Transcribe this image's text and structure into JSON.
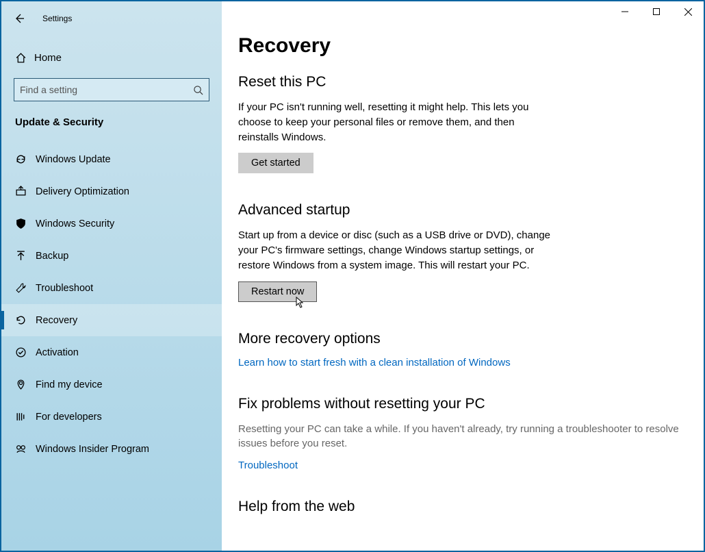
{
  "titlebar": {
    "title": "Settings"
  },
  "home_label": "Home",
  "search": {
    "placeholder": "Find a setting"
  },
  "section": "Update & Security",
  "nav": {
    "items": [
      {
        "label": "Windows Update"
      },
      {
        "label": "Delivery Optimization"
      },
      {
        "label": "Windows Security"
      },
      {
        "label": "Backup"
      },
      {
        "label": "Troubleshoot"
      },
      {
        "label": "Recovery"
      },
      {
        "label": "Activation"
      },
      {
        "label": "Find my device"
      },
      {
        "label": "For developers"
      },
      {
        "label": "Windows Insider Program"
      }
    ]
  },
  "main": {
    "heading": "Recovery",
    "reset": {
      "title": "Reset this PC",
      "desc": "If your PC isn't running well, resetting it might help. This lets you choose to keep your personal files or remove them, and then reinstalls Windows.",
      "button": "Get started"
    },
    "advanced": {
      "title": "Advanced startup",
      "desc": "Start up from a device or disc (such as a USB drive or DVD), change your PC's firmware settings, change Windows startup settings, or restore Windows from a system image. This will restart your PC.",
      "button": "Restart now"
    },
    "more": {
      "title": "More recovery options",
      "link": "Learn how to start fresh with a clean installation of Windows"
    },
    "fix": {
      "title": "Fix problems without resetting your PC",
      "desc": "Resetting your PC can take a while. If you haven't already, try running a troubleshooter to resolve issues before you reset.",
      "link": "Troubleshoot"
    },
    "help": {
      "title": "Help from the web"
    }
  }
}
